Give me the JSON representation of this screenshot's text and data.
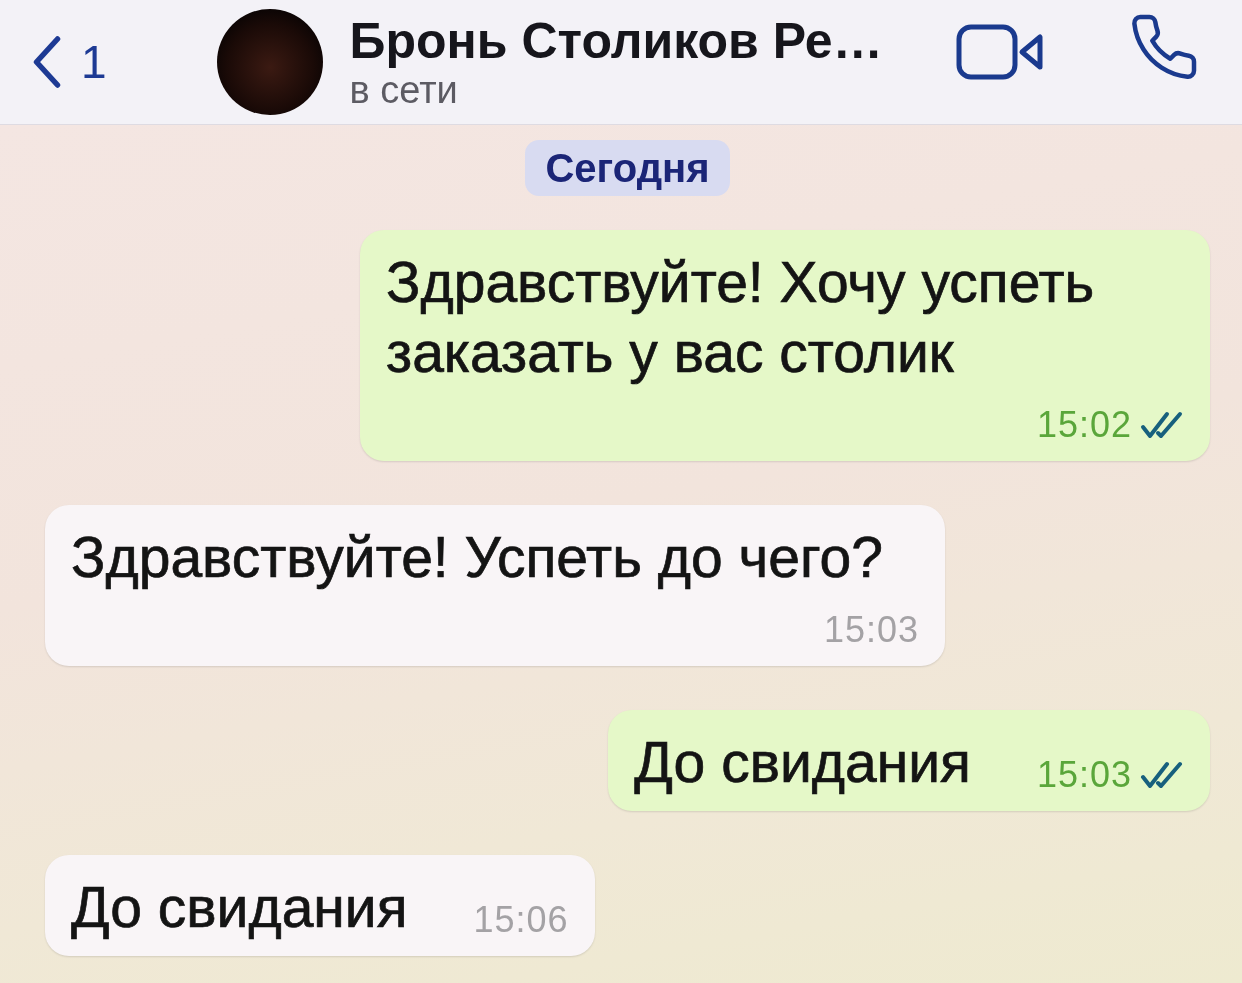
{
  "header": {
    "back_count": "1",
    "title": "Бронь Столиков Ре…",
    "status": "в сети"
  },
  "date_divider": "Сегодня",
  "messages": [
    {
      "kind": "outgoing",
      "text": "Здравствуйте! Хочу успеть заказать у вас столик",
      "time": "15:02",
      "read": true
    },
    {
      "kind": "incoming",
      "text": "Здравствуйте! Успеть до чего?",
      "time": "15:03"
    },
    {
      "kind": "outgoing",
      "text": "До свидания",
      "time": "15:03",
      "read": true
    },
    {
      "kind": "incoming",
      "text": "До свидания",
      "time": "15:06"
    }
  ]
}
